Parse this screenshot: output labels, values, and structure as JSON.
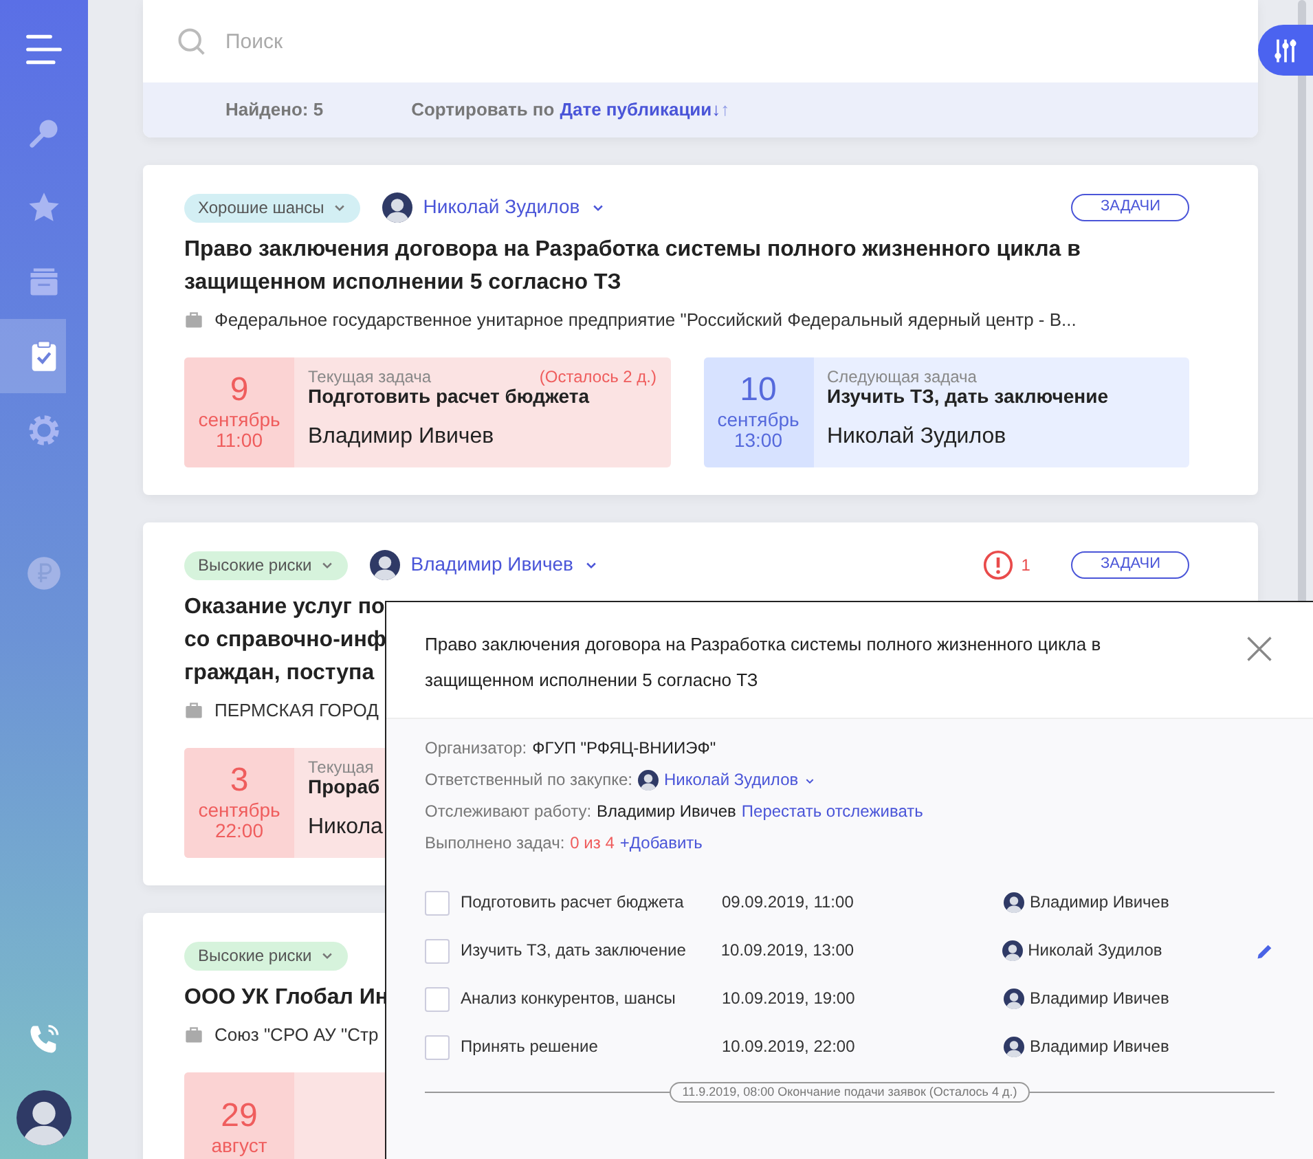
{
  "sidebar": {
    "items": [
      {
        "selected": false
      },
      {
        "selected": false
      },
      {
        "selected": false
      },
      {
        "selected": true
      },
      {
        "selected": false
      },
      {
        "selected": false
      }
    ]
  },
  "search": {
    "placeholder": "Поиск"
  },
  "results": {
    "found": "Найдено: 5",
    "sort_label": "Сортировать по",
    "sort_value": "Дате публикации↓",
    "sort_reverse": "↑"
  },
  "cards": [
    {
      "status": {
        "label": "Хорошие шансы",
        "color": "#d3eff4"
      },
      "owner": "Николай Зудилов",
      "tasks_button": "ЗАДАЧИ",
      "title_lines": [
        "Право заключения договора на Разработка системы полного жизненного цикла в защищенном исполнении 5 согласно ТЗ"
      ],
      "org": "Федеральное государственное унитарное предприятие \"Российский Федеральный ядерный центр - В...",
      "tasks": [
        {
          "kind": "current",
          "day": "9",
          "month": "сентябрь",
          "time": "11:00",
          "caption": "Текущая задача",
          "remaining": "(Осталось 2 д.)",
          "name": "Подготовить расчет бюджета",
          "person": "Владимир Ивичев"
        },
        {
          "kind": "next",
          "day": "10",
          "month": "сентябрь",
          "time": "13:00",
          "caption": "Следующая задача",
          "name": "Изучить ТЗ, дать заключение",
          "person": "Николай Зудилов"
        }
      ]
    },
    {
      "status": {
        "label": "Высокие риски",
        "color": "#d6f3dc"
      },
      "owner": "Владимир Ивичев",
      "alert_count": "1",
      "tasks_button": "ЗАДАЧИ",
      "title_lines": [
        "Оказание услуг по",
        "со справочно-инф",
        "граждан, поступа"
      ],
      "org": "ПЕРМСКАЯ ГОРОД",
      "tasks": [
        {
          "kind": "current",
          "day": "3",
          "month": "сентябрь",
          "time": "22:00",
          "caption": "Текущая",
          "name": "Прораб",
          "person": "Никола"
        }
      ]
    },
    {
      "status": {
        "label": "Высокие риски",
        "color": "#d6f3dc"
      },
      "title_lines": [
        "ООО УК Глобал Ин"
      ],
      "org": "Союз \"СРО АУ \"Стр",
      "tasks": [
        {
          "kind": "current",
          "day": "29",
          "month": "август"
        }
      ]
    }
  ],
  "modal": {
    "title": "Право заключения договора на Разработка системы полного жизненного цикла в защищенном исполнении 5 согласно ТЗ",
    "organizer_label": "Организатор:",
    "organizer": "ФГУП \"РФЯЦ-ВНИИЭФ\"",
    "responsible_label": "Ответственный по закупке:",
    "responsible": "Николай Зудилов",
    "watchers_label": "Отслеживают работу:",
    "watcher": "Владимир Ивичев",
    "unwatch_link": "Перестать отслеживать",
    "done_label": "Выполнено задач:",
    "done_value": "0 из 4",
    "add_link": "+Добавить",
    "tasks": [
      {
        "name": "Подготовить расчет бюджета",
        "date": "09.09.2019, 11:00",
        "person": "Владимир Ивичев",
        "checked": false,
        "hovered": false
      },
      {
        "name": "Изучить ТЗ, дать заключение",
        "date": "10.09.2019, 13:00",
        "person": "Николай Зудилов",
        "checked": false,
        "hovered": true
      },
      {
        "name": "Анализ конкурентов, шансы",
        "date": "10.09.2019, 19:00",
        "person": "Владимир Ивичев",
        "checked": false,
        "hovered": false
      },
      {
        "name": "Принять решение",
        "date": "10.09.2019, 22:00",
        "person": "Владимир Ивичев",
        "checked": false,
        "hovered": false
      }
    ],
    "deadline": "11.9.2019, 08:00 Окончание подачи заявок (Осталось 4 д.)"
  }
}
